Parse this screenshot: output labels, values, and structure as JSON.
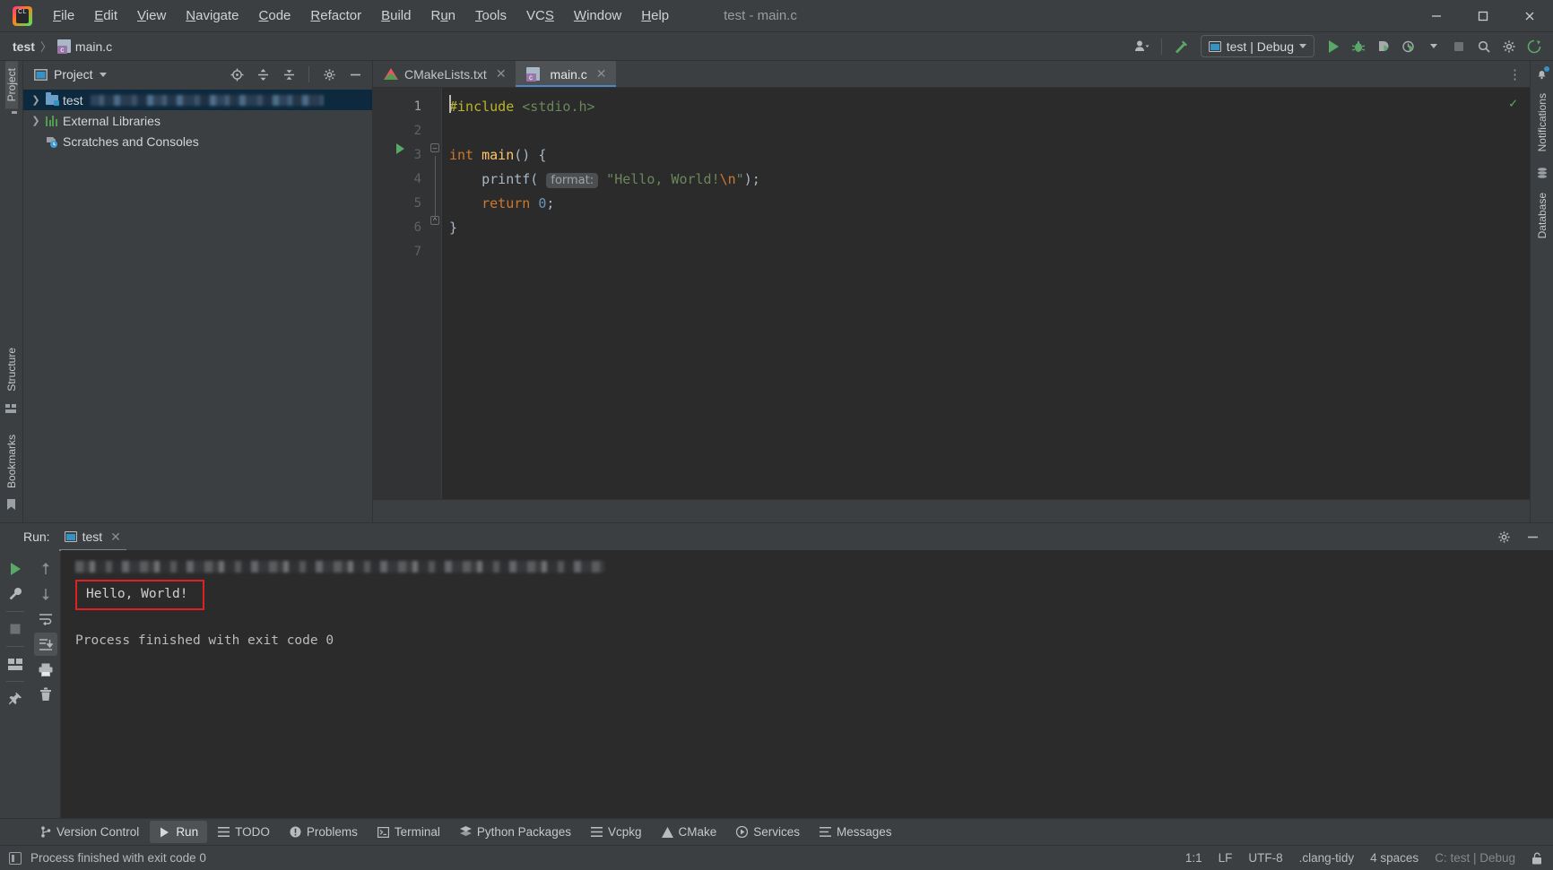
{
  "window": {
    "title": "test - main.c",
    "minimize": "—",
    "maximize": "☐",
    "close": "✕"
  },
  "menu": {
    "logo_text": "CL",
    "items": [
      {
        "label": "File",
        "mnemonic": "F"
      },
      {
        "label": "Edit",
        "mnemonic": "E"
      },
      {
        "label": "View",
        "mnemonic": "V"
      },
      {
        "label": "Navigate",
        "mnemonic": "N"
      },
      {
        "label": "Code",
        "mnemonic": "C"
      },
      {
        "label": "Refactor",
        "mnemonic": "R"
      },
      {
        "label": "Build",
        "mnemonic": "B"
      },
      {
        "label": "Run",
        "mnemonic": "u"
      },
      {
        "label": "Tools",
        "mnemonic": "T"
      },
      {
        "label": "VCS",
        "mnemonic": "S"
      },
      {
        "label": "Window",
        "mnemonic": "W"
      },
      {
        "label": "Help",
        "mnemonic": "H"
      }
    ]
  },
  "navbar": {
    "breadcrumbs": [
      "test",
      "main.c"
    ],
    "separator": "〉",
    "run_config": "test | Debug",
    "buttons": {
      "user": "user-avatar",
      "build": "build-hammer",
      "run": "run",
      "debug": "debug",
      "run_coverage": "run-with-coverage",
      "profile": "profiler",
      "stop": "stop",
      "search": "search-everywhere",
      "settings": "settings",
      "updates": "updates"
    }
  },
  "left_rail": {
    "top": [
      {
        "label": "Project",
        "icon": "folder-icon",
        "active": true
      }
    ],
    "bottom": [
      {
        "label": "Structure",
        "icon": "structure-icon"
      },
      {
        "label": "Bookmarks",
        "icon": "bookmark-icon"
      }
    ]
  },
  "right_rail": [
    {
      "label": "Notifications",
      "icon": "bell-icon",
      "badge": true
    },
    {
      "label": "Database",
      "icon": "database-icon"
    }
  ],
  "project_panel": {
    "title": "Project",
    "toolbar_icons": [
      "locate-icon",
      "expand-all-icon",
      "collapse-all-icon",
      "gear-icon",
      "hide-icon"
    ],
    "tree": [
      {
        "label": "test",
        "icon": "project-folder-icon",
        "expandable": true,
        "selected": true,
        "redacted_path": true
      },
      {
        "label": "External Libraries",
        "icon": "library-icon",
        "expandable": true,
        "selected": false
      },
      {
        "label": "Scratches and Consoles",
        "icon": "scratches-icon",
        "expandable": false,
        "selected": false
      }
    ]
  },
  "editor": {
    "tabs": [
      {
        "label": "CMakeLists.txt",
        "icon": "cmake-icon",
        "active": false,
        "close": "✕"
      },
      {
        "label": "main.c",
        "icon": "c-file-icon",
        "active": true,
        "close": "✕"
      }
    ],
    "options_icon": "⋮",
    "inspection_status": "✓",
    "line_numbers": [
      "1",
      "2",
      "3",
      "4",
      "5",
      "6",
      "7"
    ],
    "code_lines": [
      {
        "n": 1,
        "tokens": [
          {
            "t": "#include ",
            "c": "pp"
          },
          {
            "t": "<stdio.h>",
            "c": "inc"
          }
        ]
      },
      {
        "n": 2,
        "tokens": []
      },
      {
        "n": 3,
        "tokens": [
          {
            "t": "int ",
            "c": "kw"
          },
          {
            "t": "main",
            "c": "fn"
          },
          {
            "t": "() {",
            "c": "pl"
          }
        ],
        "run_marker": true
      },
      {
        "n": 4,
        "tokens": [
          {
            "t": "    printf",
            "c": "pl"
          },
          {
            "t": "( ",
            "c": "pl"
          },
          {
            "t": "format:",
            "c": "hint"
          },
          {
            "t": " ",
            "c": "pl"
          },
          {
            "t": "\"Hello, World!",
            "c": "str"
          },
          {
            "t": "\\n",
            "c": "esc"
          },
          {
            "t": "\"",
            "c": "str"
          },
          {
            "t": ");",
            "c": "pl"
          }
        ]
      },
      {
        "n": 5,
        "tokens": [
          {
            "t": "    return ",
            "c": "kw"
          },
          {
            "t": "0",
            "c": "num"
          },
          {
            "t": ";",
            "c": "pl"
          }
        ]
      },
      {
        "n": 6,
        "tokens": [
          {
            "t": "}",
            "c": "pl"
          }
        ]
      },
      {
        "n": 7,
        "tokens": []
      }
    ]
  },
  "run_window": {
    "label": "Run:",
    "tab": "test",
    "tab_icon": "run-config-icon",
    "tab_close": "✕",
    "settings_icon": "gear-icon",
    "hide_icon": "—",
    "toolbar": [
      {
        "name": "rerun-button",
        "icon": "play-icon"
      },
      {
        "name": "edit-configuration-button",
        "icon": "wrench-icon"
      },
      {
        "name": "stop-button",
        "icon": "stop-icon"
      },
      {
        "name": "layout-button",
        "icon": "layout-icon"
      },
      {
        "name": "pin-tab-button",
        "icon": "pin-icon"
      }
    ],
    "toolbar2": [
      {
        "name": "previous-occurrence-button",
        "icon": "arrow-up-icon"
      },
      {
        "name": "next-occurrence-button",
        "icon": "arrow-down-icon"
      },
      {
        "name": "soft-wrap-button",
        "icon": "wrap-icon"
      },
      {
        "name": "scroll-to-end-button",
        "icon": "scroll-end-icon",
        "active": true
      },
      {
        "name": "print-button",
        "icon": "printer-icon"
      },
      {
        "name": "clear-all-button",
        "icon": "trash-icon"
      }
    ],
    "console": {
      "command_line_redacted": true,
      "output": "Hello, World!",
      "output_highlighted": true,
      "highlight_color": "#e02020",
      "process_line": "Process finished with exit code 0"
    }
  },
  "bottom_bar": {
    "tabs": [
      {
        "label": "Version Control",
        "icon": "branch-icon",
        "active": false
      },
      {
        "label": "Run",
        "icon": "play-icon",
        "active": true
      },
      {
        "label": "TODO",
        "icon": "list-icon",
        "active": false
      },
      {
        "label": "Problems",
        "icon": "warning-icon",
        "active": false
      },
      {
        "label": "Terminal",
        "icon": "terminal-icon",
        "active": false
      },
      {
        "label": "Python Packages",
        "icon": "packages-icon",
        "active": false
      },
      {
        "label": "Vcpkg",
        "icon": "list-icon",
        "active": false
      },
      {
        "label": "CMake",
        "icon": "cmake-icon",
        "active": false
      },
      {
        "label": "Services",
        "icon": "services-icon",
        "active": false
      },
      {
        "label": "Messages",
        "icon": "messages-icon",
        "active": false
      }
    ]
  },
  "status_bar": {
    "message": "Process finished with exit code 0",
    "message_icon": "console-icon",
    "caret_position": "1:1",
    "line_separator": "LF",
    "encoding": "UTF-8",
    "inspections": ".clang-tidy",
    "indent": "4 spaces",
    "toolchain": "C: test | Debug",
    "lock_icon": "lock-open-icon"
  },
  "colors": {
    "accent_green": "#59a869",
    "accent_blue": "#3592c4",
    "highlight_red": "#e02020",
    "panel_bg": "#3c3f41",
    "editor_bg": "#2b2b2b",
    "selection_blue": "#0d293e"
  }
}
